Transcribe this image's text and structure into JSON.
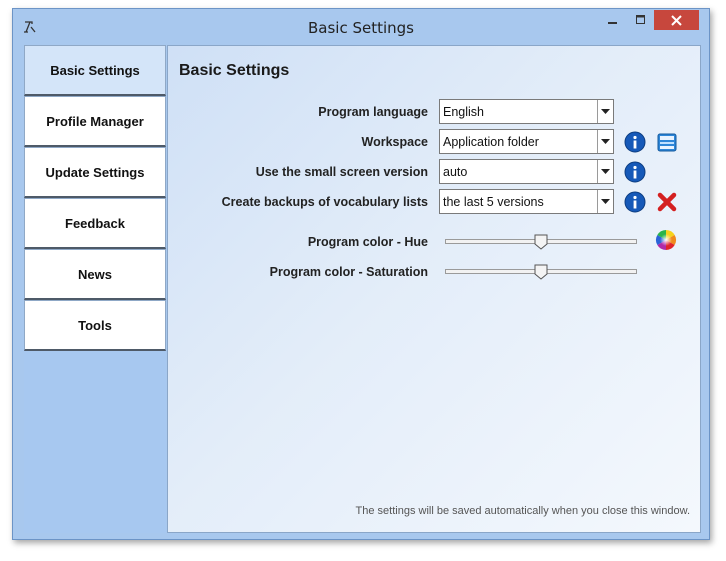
{
  "window": {
    "title": "Basic Settings"
  },
  "sidebar": {
    "items": [
      {
        "label": "Basic Settings",
        "active": true
      },
      {
        "label": "Profile Manager",
        "active": false
      },
      {
        "label": "Update Settings",
        "active": false
      },
      {
        "label": "Feedback",
        "active": false
      },
      {
        "label": "News",
        "active": false
      },
      {
        "label": "Tools",
        "active": false
      }
    ]
  },
  "content": {
    "title": "Basic Settings",
    "settings": {
      "language": {
        "label": "Program language",
        "value": "English"
      },
      "workspace": {
        "label": "Workspace",
        "value": "Application folder"
      },
      "small_screen": {
        "label": "Use the small screen version",
        "value": "auto"
      },
      "backups": {
        "label": "Create backups of vocabulary lists",
        "value": "the last 5 versions"
      },
      "hue": {
        "label": "Program color - Hue",
        "value_fraction": 0.5
      },
      "saturation": {
        "label": "Program color - Saturation",
        "value_fraction": 0.5
      }
    },
    "footer_note": "The settings will be saved automatically when you close this window."
  },
  "icons": {
    "info": "info-icon",
    "folder": "folder-icon",
    "delete": "close-x-icon",
    "color": "color-wheel-icon",
    "dropdown": "chevron-down-icon"
  },
  "colors": {
    "window_frame": "#a8c8ee",
    "close_button": "#c7473d",
    "info_blue": "#1659b8",
    "delete_red": "#d42020"
  }
}
